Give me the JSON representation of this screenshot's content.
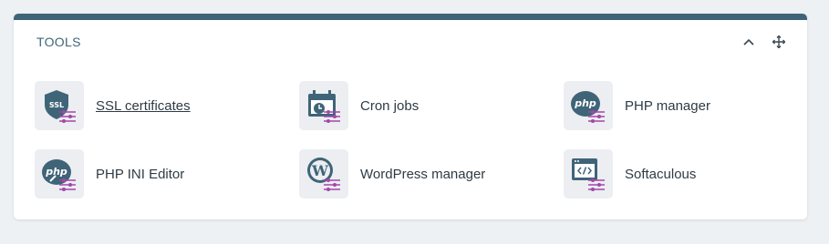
{
  "panel": {
    "title": "TOOLS",
    "actions": [
      {
        "name": "collapse",
        "icon": "chevron-up-icon"
      },
      {
        "name": "move",
        "icon": "move-arrows-icon"
      }
    ]
  },
  "colors": {
    "accent_dark": "#3f6478",
    "accent_purple": "#a347a8",
    "tile_bg": "#eceef2",
    "page_bg": "#eef1f3"
  },
  "tools": [
    {
      "label": "SSL certificates",
      "icon": "ssl-shield-icon",
      "hovered": true
    },
    {
      "label": "Cron jobs",
      "icon": "calendar-clock-icon"
    },
    {
      "label": "PHP manager",
      "icon": "php-icon"
    },
    {
      "label": "PHP INI Editor",
      "icon": "php-ini-icon"
    },
    {
      "label": "WordPress manager",
      "icon": "wordpress-icon"
    },
    {
      "label": "Softaculous",
      "icon": "code-window-icon"
    }
  ]
}
